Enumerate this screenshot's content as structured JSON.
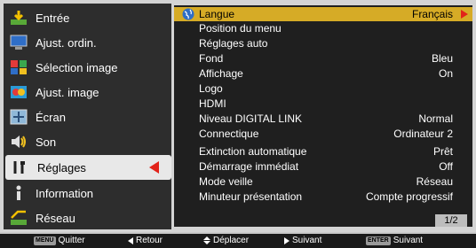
{
  "sidebar": {
    "items": [
      {
        "label": "Entrée",
        "icon": "input-icon"
      },
      {
        "label": "Ajust. ordin.",
        "icon": "computer-adjust-icon"
      },
      {
        "label": "Sélection image",
        "icon": "image-select-icon"
      },
      {
        "label": "Ajust. image",
        "icon": "image-adjust-icon"
      },
      {
        "label": "Écran",
        "icon": "screen-icon"
      },
      {
        "label": "Son",
        "icon": "sound-icon"
      },
      {
        "label": "Réglages",
        "icon": "settings-icon"
      },
      {
        "label": "Information",
        "icon": "information-icon"
      },
      {
        "label": "Réseau",
        "icon": "network-icon"
      }
    ],
    "active": "Réglages"
  },
  "menu": {
    "rows": [
      {
        "label": "Langue",
        "value": "Français"
      },
      {
        "label": "Position du menu",
        "value": ""
      },
      {
        "label": "Réglages auto",
        "value": ""
      },
      {
        "label": "Fond",
        "value": "Bleu"
      },
      {
        "label": "Affichage",
        "value": "On"
      },
      {
        "label": "Logo",
        "value": ""
      },
      {
        "label": "HDMI",
        "value": ""
      },
      {
        "label": "Niveau DIGITAL LINK",
        "value": "Normal"
      },
      {
        "label": "Connectique",
        "value": "Ordinateur 2"
      },
      {
        "label": "Extinction automatique",
        "value": "Prêt"
      },
      {
        "label": "Démarrage immédiat",
        "value": "Off"
      },
      {
        "label": "Mode veille",
        "value": "Réseau"
      },
      {
        "label": "Minuteur présentation",
        "value": "Compte progressif"
      }
    ],
    "page": "1/2"
  },
  "bottom": {
    "quit_key": "MENU",
    "quit_label": "Quitter",
    "back_label": "Retour",
    "move_label": "Déplacer",
    "next_label": "Suivant",
    "enter_key": "ENTER",
    "enter_label": "Suivant"
  },
  "colors": {
    "highlight": "#d6ab26",
    "arrow": "#e2231a",
    "panel": "#1f1f1f"
  }
}
